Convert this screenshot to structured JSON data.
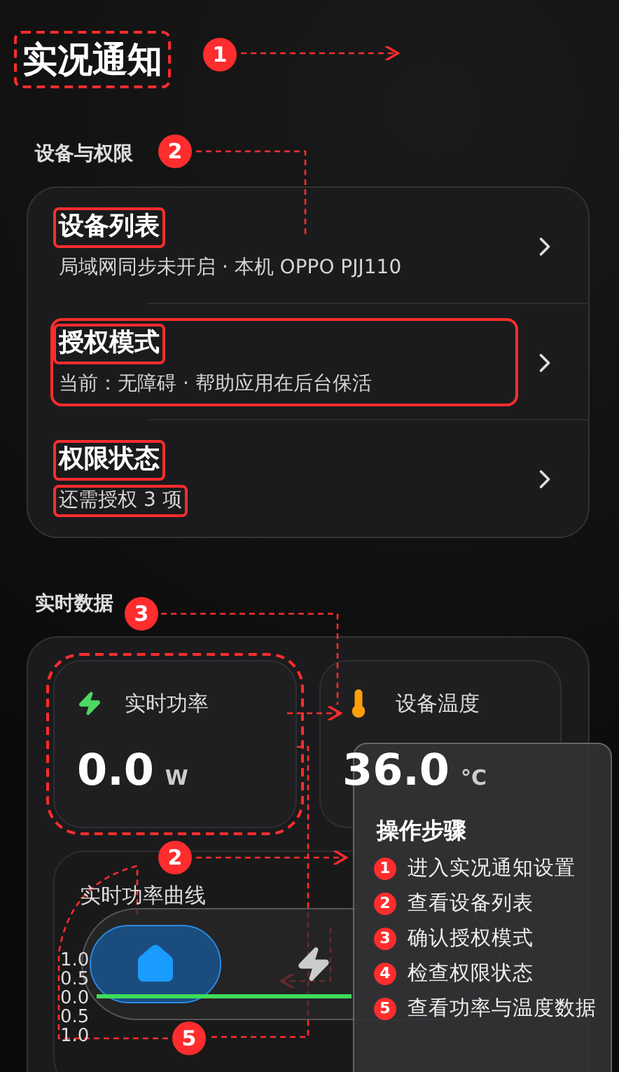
{
  "header": {
    "title": "实况通知",
    "boxed": true
  },
  "device_section": {
    "label": "设备与权限",
    "rows": [
      {
        "title": "设备列表",
        "subtitle": "局域网同步未开启 · 本机 OPPO PJJ110",
        "title_boxed": true,
        "subtitle_boxed": false,
        "row_boxed": false
      },
      {
        "title": "授权模式",
        "subtitle": "当前：无障碍 · 帮助应用在后台保活",
        "title_boxed": true,
        "subtitle_boxed": false,
        "row_boxed": true
      },
      {
        "title": "权限状态",
        "subtitle": "还需授权 3 项",
        "title_boxed": true,
        "subtitle_boxed": true,
        "row_boxed": false
      }
    ]
  },
  "data_section": {
    "label": "实时数据",
    "tiles": [
      {
        "kind": "power",
        "label": "实时功率",
        "value": "0.0",
        "unit": "W",
        "boxed": true
      },
      {
        "kind": "temperature",
        "label": "设备温度",
        "value": "36.0",
        "unit": "°C",
        "boxed": false
      }
    ],
    "chart": {
      "title": "实时功率曲线",
      "chart_data": {
        "type": "line",
        "ylim": [
          -1,
          1
        ],
        "yticks": [
          {
            "value": 1,
            "label": "1.0"
          },
          {
            "value": 0.5,
            "label": "0.5"
          },
          {
            "value": 0,
            "label": "0.0"
          },
          {
            "value": -0.5,
            "label": "0.5"
          },
          {
            "value": -1,
            "label": "1.0"
          }
        ],
        "series": [
          {
            "color": "#3ddc5a",
            "values": [
              0,
              0,
              0,
              0,
              0,
              0
            ]
          }
        ]
      }
    }
  },
  "nav": {
    "items": [
      {
        "kind": "home",
        "selected": true
      },
      {
        "kind": "power",
        "selected": false
      }
    ]
  },
  "steps_panel": {
    "title": "操作步骤",
    "steps": [
      {
        "number": "1",
        "text": "进入实况通知设置"
      },
      {
        "number": "2",
        "text": "查看设备列表"
      },
      {
        "number": "3",
        "text": "确认授权模式"
      },
      {
        "number": "4",
        "text": "检查权限状态"
      },
      {
        "number": "5",
        "text": "查看功率与温度数据"
      }
    ]
  },
  "annotations": [
    {
      "number": "1"
    },
    {
      "number": "2"
    },
    {
      "number": "3"
    },
    {
      "number": "2"
    },
    {
      "number": "5"
    }
  ]
}
